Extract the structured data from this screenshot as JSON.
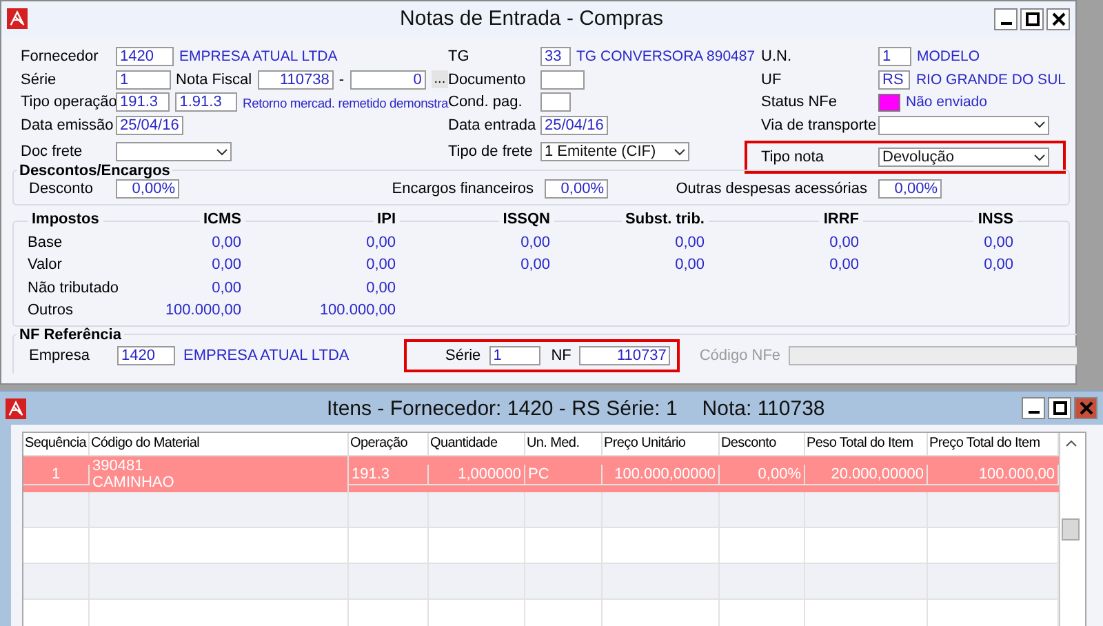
{
  "window": {
    "title": "Notas de Entrada - Compras"
  },
  "form_rows": [
    [
      {
        "label": "Fornecedor",
        "highlighted": false,
        "controls": [
          {
            "kind": "code",
            "value": "1420"
          },
          {
            "kind": "text",
            "value": "EMPRESA ATUAL LTDA"
          }
        ]
      },
      {
        "label": "TG",
        "highlighted": false,
        "controls": [
          {
            "kind": "code",
            "value": "33"
          },
          {
            "kind": "text",
            "value": "TG CONVERSORA 890487"
          }
        ]
      },
      {
        "label": "U.N.",
        "highlighted": false,
        "controls": [
          {
            "kind": "code",
            "value": "1"
          },
          {
            "kind": "text",
            "value": "MODELO"
          }
        ]
      }
    ],
    [
      {
        "label": "Série",
        "highlighted": false,
        "controls": [
          {
            "kind": "code",
            "value": "1"
          },
          {
            "kind": "label",
            "value": "Nota Fiscal"
          },
          {
            "kind": "number",
            "value": "110738"
          },
          {
            "kind": "label",
            "value": "-"
          },
          {
            "kind": "number",
            "value": "0"
          },
          {
            "kind": "button",
            "value": "..."
          }
        ]
      },
      {
        "label": "Documento",
        "highlighted": false,
        "controls": [
          {
            "kind": "code"
          }
        ]
      },
      {
        "label": "UF",
        "highlighted": false,
        "controls": [
          {
            "kind": "code",
            "value": "RS"
          },
          {
            "kind": "text",
            "value": "RIO GRANDE DO SUL"
          }
        ]
      }
    ],
    [
      {
        "label": "Tipo operação",
        "highlighted": false,
        "controls": [
          {
            "kind": "code",
            "value": "191.3"
          },
          {
            "kind": "code",
            "value": "1.91.3"
          },
          {
            "kind": "text",
            "value": "Retorno mercad. remetido demonstra"
          }
        ]
      },
      {
        "label": "Cond. pag.",
        "highlighted": false,
        "controls": [
          {
            "kind": "code"
          }
        ]
      },
      {
        "label": "Status NFe",
        "highlighted": false,
        "controls": [
          {
            "kind": "swatch",
            "color": "#ff00ff"
          },
          {
            "kind": "text",
            "value": "Não enviado"
          }
        ]
      }
    ],
    [
      {
        "label": "Data emissão",
        "highlighted": false,
        "controls": [
          {
            "kind": "code",
            "value": "25/04/16"
          }
        ]
      },
      {
        "label": "Data entrada",
        "highlighted": false,
        "controls": [
          {
            "kind": "code",
            "value": "25/04/16"
          }
        ]
      },
      {
        "label": "Via de transporte",
        "highlighted": false,
        "controls": [
          {
            "kind": "select"
          }
        ]
      }
    ],
    [
      {
        "label": "Doc frete",
        "highlighted": false,
        "controls": [
          {
            "kind": "select"
          }
        ]
      },
      {
        "label": "Tipo de frete",
        "highlighted": false,
        "controls": [
          {
            "kind": "select",
            "value": "1 Emitente (CIF)"
          }
        ]
      },
      {
        "label": "Tipo nota",
        "highlighted": true,
        "controls": [
          {
            "kind": "select",
            "value": "Devolução"
          }
        ]
      }
    ]
  ],
  "descontos": {
    "title": "Descontos/Encargos",
    "fields": [
      {
        "label": "Desconto",
        "value": "0,00%"
      },
      {
        "label": "Encargos financeiros",
        "value": "0,00%"
      },
      {
        "label": "Outras despesas acessórias",
        "value": "0,00%"
      }
    ]
  },
  "impostos": {
    "title": "Impostos",
    "columns": [
      "ICMS",
      "IPI",
      "ISSQN",
      "Subst. trib.",
      "IRRF",
      "INSS"
    ],
    "rows": [
      {
        "label": "Base",
        "values": [
          "0,00",
          "0,00",
          "0,00",
          "0,00",
          "0,00",
          "0,00"
        ]
      },
      {
        "label": "Valor",
        "values": [
          "0,00",
          "0,00",
          "0,00",
          "0,00",
          "0,00",
          "0,00"
        ]
      },
      {
        "label": "Não tributado",
        "values": [
          "0,00",
          "0,00"
        ]
      },
      {
        "label": "Outros",
        "values": [
          "100.000,00",
          "100.000,00"
        ]
      }
    ]
  },
  "nf_referencia": {
    "title": "NF Referência",
    "empresa_label": "Empresa",
    "empresa_code": "1420",
    "empresa_name": "EMPRESA ATUAL LTDA",
    "highlighted": true,
    "serie_label": "Série",
    "serie": "1",
    "nf_label": "NF",
    "nf": "110737",
    "codigo_nfe_label": "Código NFe",
    "codigo_nfe_disabled": true
  },
  "items_window": {
    "title": "Itens - Fornecedor: 1420 - RS Série: 1",
    "nota": "Nota: 110738"
  },
  "items_table": {
    "columns": [
      "Sequência",
      "Código do Material",
      "Operação",
      "Quantidade",
      "Un. Med.",
      "Preço Unitário",
      "Desconto",
      "Peso Total do Item",
      "Preço Total do Item"
    ],
    "rows": [
      {
        "selected": true,
        "cells": [
          "1",
          "390481",
          "191.3",
          "1,000000",
          "PC",
          "100.000,00000",
          "0,00%",
          "20.000,00000",
          "100.000,00"
        ],
        "description": "CAMINHAO"
      }
    ]
  }
}
